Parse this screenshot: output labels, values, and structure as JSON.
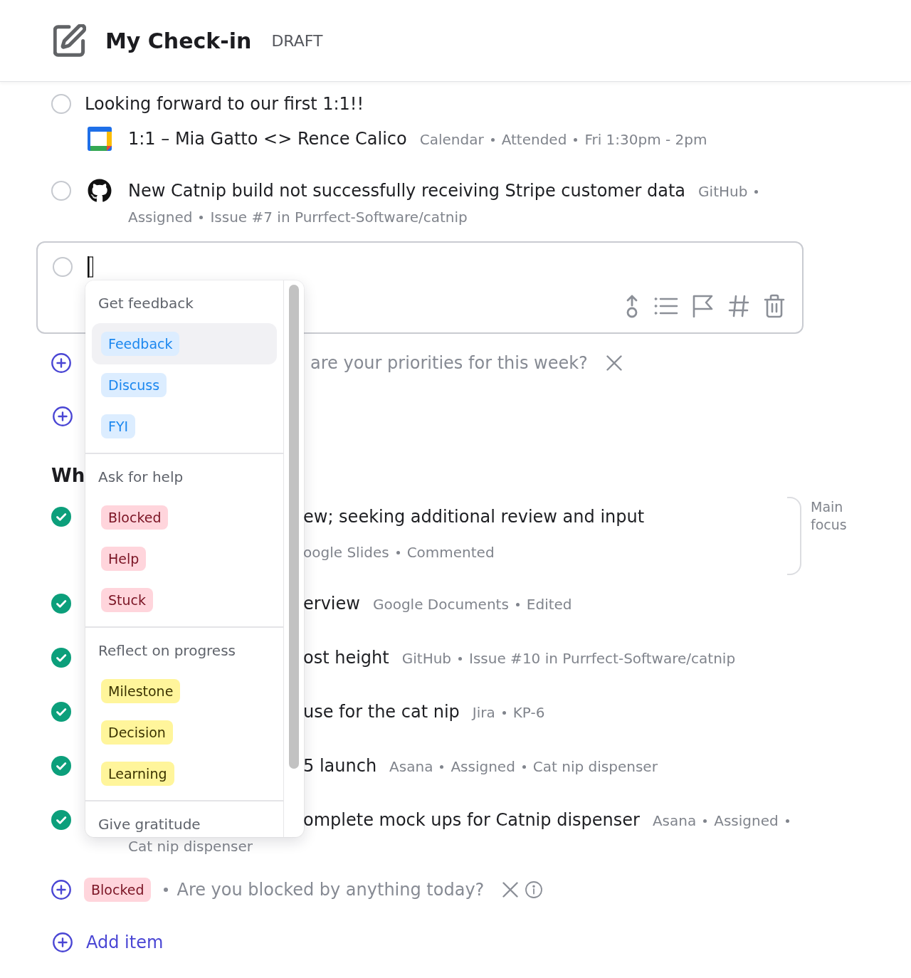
{
  "header": {
    "title": "My Check-in",
    "status": "DRAFT"
  },
  "items": [
    {
      "kind": "note",
      "checked": false,
      "text": "Looking forward to our first 1:1!!",
      "attachment": {
        "title": "1:1 – Mia Gatto <> Rence Calico",
        "meta": [
          "Calendar",
          "Attended",
          "Fri 1:30pm - 2pm"
        ]
      }
    },
    {
      "kind": "issue",
      "checked": false,
      "text": "New Catnip build not successfully receiving Stripe customer data",
      "meta": [
        "GitHub",
        "Assigned",
        "Issue #7 in Purrfect-Software/catnip"
      ]
    }
  ],
  "editor": {
    "checked": false
  },
  "prompts": [
    {
      "kind": "question",
      "text": "are your priorities for this week?"
    },
    {
      "kind": "blank"
    }
  ],
  "section": {
    "heading": "Wh",
    "items": [
      {
        "kind": "stacked",
        "checked": true,
        "text": "ew; seeking additional review and input",
        "meta": [
          "oogle Slides",
          "Commented"
        ],
        "group_label": "Main focus"
      },
      {
        "kind": "inline",
        "checked": true,
        "text": "erview",
        "meta": [
          "Google Documents",
          "Edited"
        ]
      },
      {
        "kind": "inline",
        "checked": true,
        "text": "ost height",
        "meta": [
          "GitHub",
          "Issue #10 in Purrfect-Software/catnip"
        ]
      },
      {
        "kind": "inline",
        "checked": true,
        "text": "use for the cat nip",
        "meta": [
          "Jira",
          "KP-6"
        ]
      },
      {
        "kind": "inline",
        "checked": true,
        "text": "5 launch",
        "meta": [
          "Asana",
          "Assigned",
          "Cat nip dispenser"
        ]
      },
      {
        "kind": "inline",
        "checked": true,
        "text": "omplete mock ups for Catnip dispenser",
        "meta": [
          "Asana",
          "Assigned",
          "Cat nip dispenser"
        ]
      }
    ]
  },
  "blocker": {
    "tag": {
      "label": "Blocked",
      "kind": "danger"
    },
    "text": "Are you blocked by anything today?"
  },
  "add_item": "Add item",
  "menu": {
    "groups": [
      {
        "title": "Get feedback",
        "kind": "info",
        "items": [
          {
            "label": "Feedback",
            "selected": true
          },
          {
            "label": "Discuss",
            "selected": false
          },
          {
            "label": "FYI",
            "selected": false
          }
        ]
      },
      {
        "title": "Ask for help",
        "kind": "danger",
        "items": [
          {
            "label": "Blocked",
            "selected": false
          },
          {
            "label": "Help",
            "selected": false
          },
          {
            "label": "Stuck",
            "selected": false
          }
        ]
      },
      {
        "title": "Reflect on progress",
        "kind": "warning",
        "items": [
          {
            "label": "Milestone",
            "selected": false
          },
          {
            "label": "Decision",
            "selected": false
          },
          {
            "label": "Learning",
            "selected": false
          }
        ]
      },
      {
        "title": "Give gratitude"
      }
    ]
  }
}
